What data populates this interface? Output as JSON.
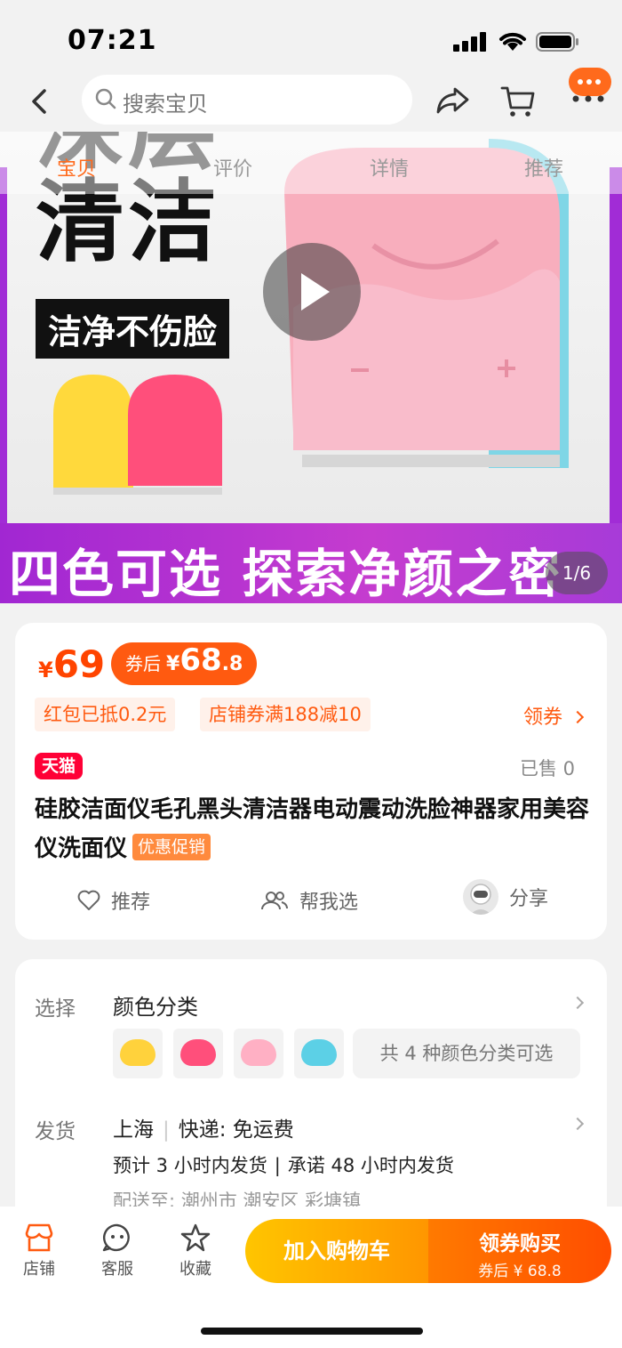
{
  "status": {
    "time": "07:21"
  },
  "nav": {
    "search_placeholder": "搜索宝贝"
  },
  "hero": {
    "tabs": [
      "宝贝",
      "评价",
      "详情",
      "推荐"
    ],
    "text_top": "深层",
    "text_main": "清洁",
    "tagline": "洁净不伤脸",
    "banner": "四色可选 探索净颜之密",
    "page_indicator": "1/6"
  },
  "price": {
    "currency": "¥",
    "value": "69",
    "coupon_label": "券后",
    "coupon_currency": "¥",
    "coupon_int": "68",
    "coupon_dec": ".8",
    "promo_tags": [
      "红包已抵0.2元",
      "店铺券满188减10"
    ],
    "claim_label": "领券"
  },
  "product": {
    "store_badge": "天猫",
    "sold": "已售 0",
    "title": "硅胶洁面仪毛孔黑头清洁器电动震动洗脸神器家用美容仪洗面仪",
    "title_badge": "优惠促销"
  },
  "actions": {
    "recommend": "推荐",
    "help_choose": "帮我选",
    "share": "分享"
  },
  "options": {
    "select_label": "选择",
    "select_title": "颜色分类",
    "swatch_colors": [
      "#ffd23c",
      "#ff4f7b",
      "#ffb0c4",
      "#5cd0e6"
    ],
    "swatch_count_text": "共 4 种颜色分类可选",
    "ship_label": "发货",
    "ship_from": "上海",
    "ship_express": "快递: 免运费",
    "ship_eta_a": "预计 3 小时内发货",
    "ship_eta_b": "承诺 48 小时内发货",
    "ship_dest": "配送至: 潮州市 潮安区 彩塘镇"
  },
  "bottom": {
    "store": "店铺",
    "service": "客服",
    "favorite": "收藏",
    "add_cart": "加入购物车",
    "buy_main": "领券购买",
    "buy_sub": "券后 ¥ 68.8"
  },
  "colors": {
    "accent": "#ff5a10",
    "tmall": "#ff0036",
    "banner": "#a127d2"
  }
}
